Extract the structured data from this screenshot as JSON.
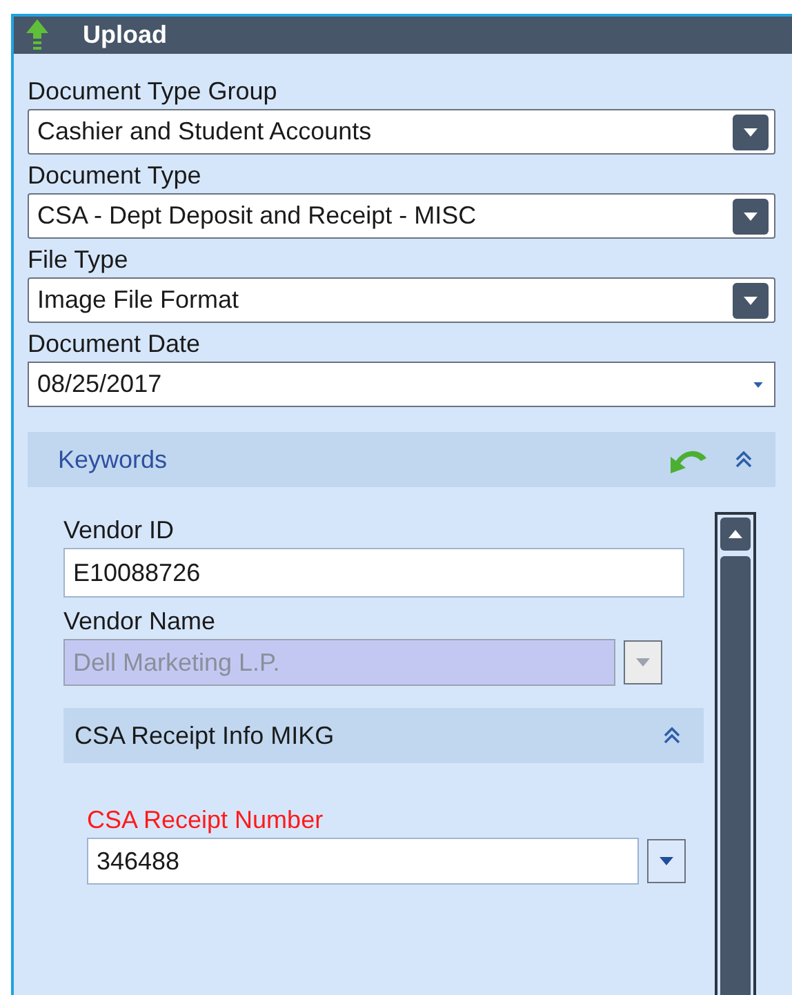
{
  "panel": {
    "title": "Upload"
  },
  "fields": [
    {
      "label": "Document Type Group",
      "kind": "dropdown",
      "value": "Cashier and Student Accounts"
    },
    {
      "label": "Document Type",
      "kind": "dropdown",
      "value": "CSA - Dept Deposit and Receipt - MISC"
    },
    {
      "label": "File Type",
      "kind": "dropdown",
      "value": "Image File Format"
    },
    {
      "label": "Document Date",
      "kind": "date",
      "value": "08/25/2017"
    }
  ],
  "keywords": {
    "title": "Keywords",
    "expanded": true,
    "fields": [
      {
        "label": "Vendor ID",
        "kind": "text",
        "value": "E10088726",
        "disabled": false,
        "required": false
      },
      {
        "label": "Vendor Name",
        "kind": "combo",
        "value": "Dell Marketing L.P.",
        "disabled": true,
        "required": false
      }
    ],
    "group": {
      "title": "CSA Receipt Info MIKG",
      "expanded": true,
      "fields": [
        {
          "label": "CSA Receipt Number",
          "kind": "combo",
          "value": "346488",
          "disabled": false,
          "required": true
        }
      ]
    }
  }
}
